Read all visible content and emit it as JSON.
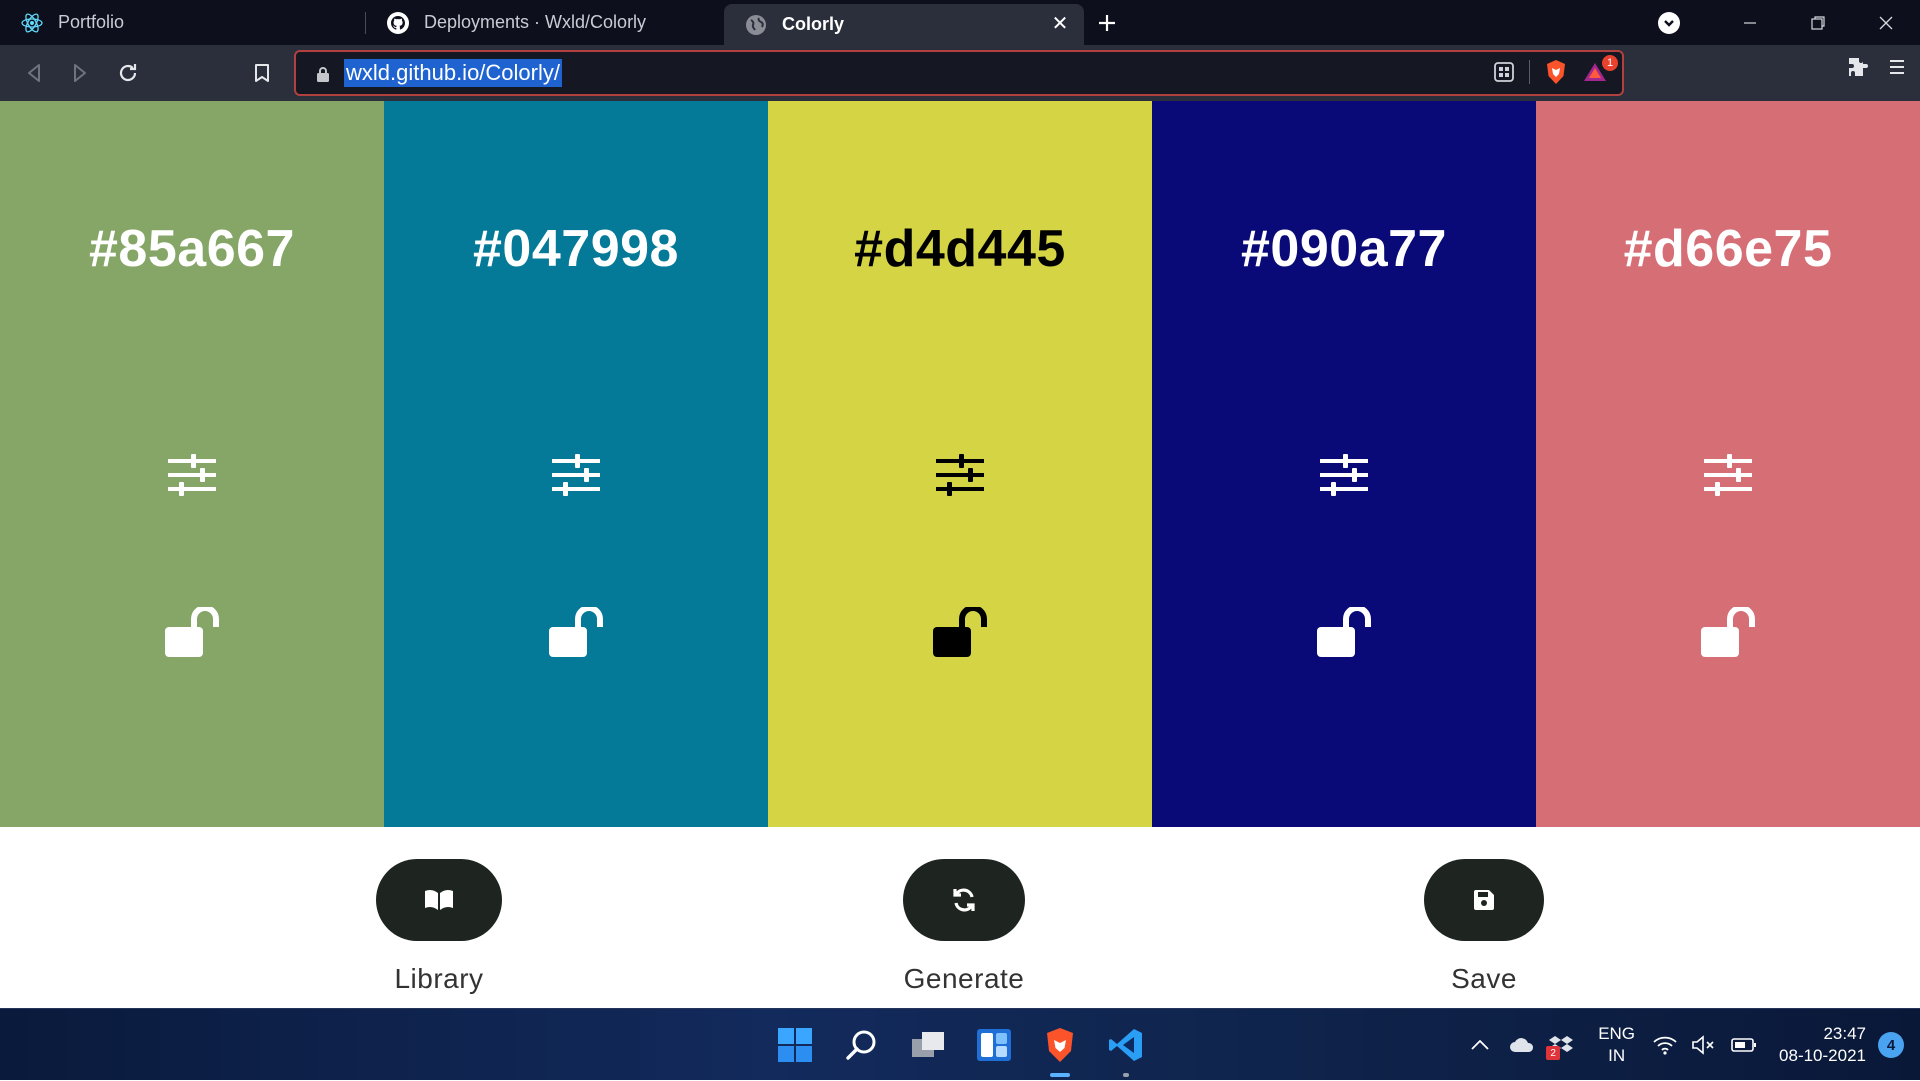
{
  "browser": {
    "tabs": [
      {
        "title": "Portfolio",
        "icon": "react-icon"
      },
      {
        "title": "Deployments · Wxld/Colorly",
        "icon": "github-icon"
      },
      {
        "title": "Colorly",
        "icon": "globe-icon",
        "active": true
      }
    ],
    "url": "wxld.github.io/Colorly/",
    "shield_badge": "1"
  },
  "palette": {
    "colors": [
      {
        "hex": "#85a667",
        "text_color": "#ffffff"
      },
      {
        "hex": "#047998",
        "text_color": "#ffffff"
      },
      {
        "hex": "#d4d445",
        "text_color": "#000000"
      },
      {
        "hex": "#090a77",
        "text_color": "#ffffff"
      },
      {
        "hex": "#d66e75",
        "text_color": "#ffffff"
      }
    ]
  },
  "controls": {
    "library_label": "Library",
    "generate_label": "Generate",
    "save_label": "Save"
  },
  "taskbar": {
    "lang_top": "ENG",
    "lang_bottom": "IN",
    "time": "23:47",
    "date": "08-10-2021",
    "notifications": "4",
    "dropbox_badge": "2"
  }
}
